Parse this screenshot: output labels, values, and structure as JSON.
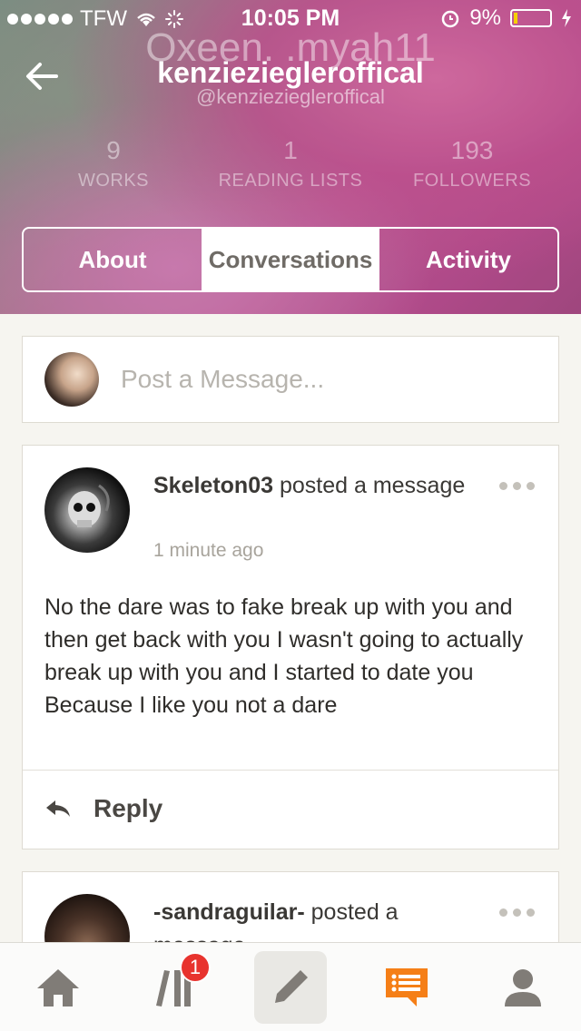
{
  "status_bar": {
    "carrier": "TFW",
    "time": "10:05 PM",
    "battery_percent": "9%",
    "battery_level": 0.09,
    "icons": [
      "signal-dots-icon",
      "wifi-icon",
      "loading-icon",
      "alarm-icon",
      "charging-icon"
    ]
  },
  "profile": {
    "ghost_name": "Oxeen.  .myah11",
    "username": "kenzieziegleroffical",
    "handle": "@kenzieziegleroffical",
    "stats": [
      {
        "value": "9",
        "label": "WORKS"
      },
      {
        "value": "1",
        "label": "READING LISTS"
      },
      {
        "value": "193",
        "label": "FOLLOWERS"
      }
    ]
  },
  "tabs": [
    {
      "label": "About",
      "active": false
    },
    {
      "label": "Conversations",
      "active": true
    },
    {
      "label": "Activity",
      "active": false
    }
  ],
  "post_box": {
    "placeholder": "Post a Message..."
  },
  "messages": [
    {
      "author": "Skeleton03",
      "action": "posted a message",
      "time": "1 minute ago",
      "body": "No the dare was to fake break up with you and then get back with you I wasn't going to actually break up with you and I started to date you Because I like you not a dare",
      "reply_label": "Reply"
    },
    {
      "author": "-sandraguilar-",
      "action": "posted a message"
    }
  ],
  "bottom_nav": {
    "items": [
      "home-icon",
      "library-icon",
      "write-icon",
      "messages-icon",
      "profile-icon"
    ],
    "library_badge": "1",
    "accent_color": "#f57f17"
  }
}
